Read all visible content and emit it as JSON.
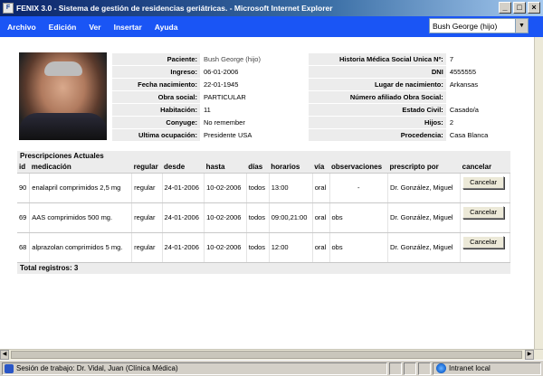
{
  "window": {
    "title": "FENIX 3.0 - Sistema de gestión de residencias geriátricas. - Microsoft Internet Explorer",
    "app_icon": "F"
  },
  "menu": {
    "items": [
      "Archivo",
      "Edición",
      "Ver",
      "Insertar",
      "Ayuda"
    ],
    "patient_select": "Bush George (hijo)"
  },
  "patient": {
    "fields": [
      {
        "label": "Paciente:",
        "value": "Bush George (hijo)",
        "label2": "Historia Médica Social Unica Nº:",
        "value2": "7"
      },
      {
        "label": "Ingreso:",
        "value": "06-01-2006",
        "label2": "DNI",
        "value2": "4555555"
      },
      {
        "label": "Fecha nacimiento:",
        "value": "22-01-1945",
        "label2": "Lugar de nacimiento:",
        "value2": "Arkansas"
      },
      {
        "label": "Obra social:",
        "value": "PARTICULAR",
        "label2": "Número afiliado Obra Social:",
        "value2": ""
      },
      {
        "label": "Habitación:",
        "value": "11",
        "label2": "Estado Civil:",
        "value2": "Casado/a"
      },
      {
        "label": "Conyuge:",
        "value": "No remember",
        "label2": "Hijos:",
        "value2": "2"
      },
      {
        "label": "Ultima ocupación:",
        "value": "Presidente USA",
        "label2": "Procedencia:",
        "value2": "Casa Blanca"
      }
    ]
  },
  "prescriptions": {
    "title": "Prescripciones Actuales",
    "columns": [
      "id",
      "medicación",
      "regular",
      "desde",
      "hasta",
      "días",
      "horarios",
      "vía",
      "observaciones",
      "prescripto por",
      "cancelar"
    ],
    "rows": [
      {
        "id": "90",
        "medicacion": "enalapril comprimidos 2,5 mg",
        "regular": "regular",
        "desde": "24-01-2006",
        "hasta": "10-02-2006",
        "dias": "todos",
        "horarios": "13:00",
        "via": "oral",
        "observaciones": "-",
        "prescripto": "Dr. González, Miguel",
        "cancel_label": "Cancelar"
      },
      {
        "id": "69",
        "medicacion": "AAS comprimidos 500 mg.",
        "regular": "regular",
        "desde": "24-01-2006",
        "hasta": "10-02-2006",
        "dias": "todos",
        "horarios": "09:00,21:00",
        "via": "oral",
        "observaciones": "obs",
        "prescripto": "Dr. González, Miguel",
        "cancel_label": "Cancelar"
      },
      {
        "id": "68",
        "medicacion": "alprazolan comprimidos 5 mg.",
        "regular": "regular",
        "desde": "24-01-2006",
        "hasta": "10-02-2006",
        "dias": "todos",
        "horarios": "12:00",
        "via": "oral",
        "observaciones": "obs",
        "prescripto": "Dr. González, Miguel",
        "cancel_label": "Cancelar"
      }
    ],
    "total": "Total registros: 3"
  },
  "status": {
    "session": "Sesión de trabajo: Dr. Vidal, Juan (Clínica Médica)",
    "zone": "Intranet local"
  },
  "colors": {
    "menubar": "#1a55f5",
    "label_bg": "#ececec"
  }
}
